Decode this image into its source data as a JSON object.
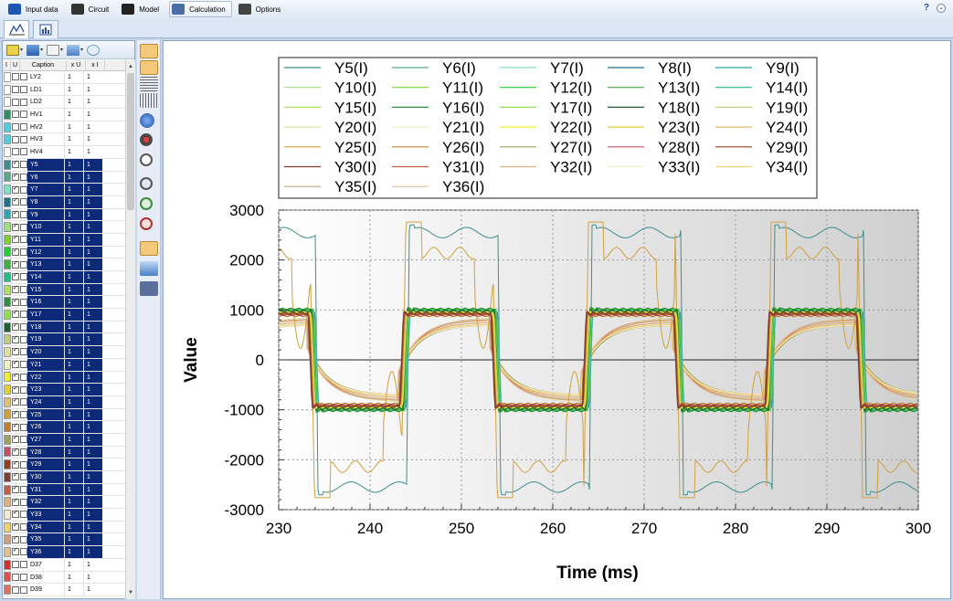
{
  "menu": [
    {
      "label": "Input data",
      "icon": "input-data-icon"
    },
    {
      "label": "Circuit",
      "icon": "circuit-icon"
    },
    {
      "label": "Model",
      "icon": "model-icon"
    },
    {
      "label": "Calculation",
      "icon": "calculation-icon",
      "active": true
    },
    {
      "label": "Options",
      "icon": "options-icon"
    }
  ],
  "help_label": "?",
  "grid": {
    "headers": [
      "I",
      "U",
      "Caption",
      "x U",
      "x I"
    ],
    "rows": [
      {
        "caption": "LY2",
        "color": "#ffffff",
        "i": false,
        "u": false,
        "xu": "1",
        "xi": "1",
        "sel": false
      },
      {
        "caption": "LD1",
        "color": "#ffffff",
        "i": false,
        "u": false,
        "xu": "1",
        "xi": "1",
        "sel": false
      },
      {
        "caption": "LD2",
        "color": "#ffffff",
        "i": false,
        "u": false,
        "xu": "1",
        "xi": "1",
        "sel": false
      },
      {
        "caption": "HV1",
        "color": "#2f8f5f",
        "i": false,
        "u": false,
        "xu": "1",
        "xi": "1",
        "sel": false
      },
      {
        "caption": "HV2",
        "color": "#4fd0e0",
        "i": false,
        "u": false,
        "xu": "1",
        "xi": "1",
        "sel": false
      },
      {
        "caption": "HV3",
        "color": "#4fd0e0",
        "i": false,
        "u": false,
        "xu": "1",
        "xi": "1",
        "sel": false
      },
      {
        "caption": "HV4",
        "color": "#ffffff",
        "i": false,
        "u": false,
        "xu": "1",
        "xi": "1",
        "sel": false
      },
      {
        "caption": "Y5",
        "color": "#3d8e8e",
        "i": true,
        "u": false,
        "xu": "1",
        "xi": "1",
        "sel": true
      },
      {
        "caption": "Y6",
        "color": "#5aa88a",
        "i": true,
        "u": false,
        "xu": "1",
        "xi": "1",
        "sel": true
      },
      {
        "caption": "Y7",
        "color": "#7fe0c8",
        "i": true,
        "u": false,
        "xu": "1",
        "xi": "1",
        "sel": true
      },
      {
        "caption": "Y8",
        "color": "#1f6f8f",
        "i": true,
        "u": false,
        "xu": "1",
        "xi": "1",
        "sel": true
      },
      {
        "caption": "Y9",
        "color": "#2fa3b5",
        "i": true,
        "u": false,
        "xu": "1",
        "xi": "1",
        "sel": true
      },
      {
        "caption": "Y10",
        "color": "#9fe07f",
        "i": true,
        "u": false,
        "xu": "1",
        "xi": "1",
        "sel": true
      },
      {
        "caption": "Y11",
        "color": "#7fd02f",
        "i": true,
        "u": false,
        "xu": "1",
        "xi": "1",
        "sel": true
      },
      {
        "caption": "Y12",
        "color": "#1fd02f",
        "i": true,
        "u": false,
        "xu": "1",
        "xi": "1",
        "sel": true
      },
      {
        "caption": "Y13",
        "color": "#3fb03f",
        "i": true,
        "u": false,
        "xu": "1",
        "xi": "1",
        "sel": true
      },
      {
        "caption": "Y14",
        "color": "#1fc07f",
        "i": true,
        "u": false,
        "xu": "1",
        "xi": "1",
        "sel": true
      },
      {
        "caption": "Y15",
        "color": "#afe05f",
        "i": true,
        "u": false,
        "xu": "1",
        "xi": "1",
        "sel": true
      },
      {
        "caption": "Y16",
        "color": "#2f8f3f",
        "i": true,
        "u": false,
        "xu": "1",
        "xi": "1",
        "sel": true
      },
      {
        "caption": "Y17",
        "color": "#8fe04f",
        "i": true,
        "u": false,
        "xu": "1",
        "xi": "1",
        "sel": true
      },
      {
        "caption": "Y18",
        "color": "#1f5f2f",
        "i": true,
        "u": false,
        "xu": "1",
        "xi": "1",
        "sel": true
      },
      {
        "caption": "Y19",
        "color": "#bfcf7f",
        "i": true,
        "u": false,
        "xu": "1",
        "xi": "1",
        "sel": true
      },
      {
        "caption": "Y20",
        "color": "#e0e0a0",
        "i": true,
        "u": false,
        "xu": "1",
        "xi": "1",
        "sel": true
      },
      {
        "caption": "Y21",
        "color": "#f0f0c0",
        "i": true,
        "u": false,
        "xu": "1",
        "xi": "1",
        "sel": true
      },
      {
        "caption": "Y22",
        "color": "#efef2f",
        "i": true,
        "u": false,
        "xu": "1",
        "xi": "1",
        "sel": true
      },
      {
        "caption": "Y23",
        "color": "#e0d02f",
        "i": true,
        "u": false,
        "xu": "1",
        "xi": "1",
        "sel": true
      },
      {
        "caption": "Y24",
        "color": "#e0c070",
        "i": true,
        "u": false,
        "xu": "1",
        "xi": "1",
        "sel": true
      },
      {
        "caption": "Y25",
        "color": "#d0a040",
        "i": true,
        "u": false,
        "xu": "1",
        "xi": "1",
        "sel": true
      },
      {
        "caption": "Y26",
        "color": "#c08030",
        "i": true,
        "u": false,
        "xu": "1",
        "xi": "1",
        "sel": true
      },
      {
        "caption": "Y27",
        "color": "#a0a060",
        "i": true,
        "u": false,
        "xu": "1",
        "xi": "1",
        "sel": true
      },
      {
        "caption": "Y28",
        "color": "#c05060",
        "i": true,
        "u": false,
        "xu": "1",
        "xi": "1",
        "sel": true
      },
      {
        "caption": "Y29",
        "color": "#8f3f1f",
        "i": true,
        "u": false,
        "xu": "1",
        "xi": "1",
        "sel": true
      },
      {
        "caption": "Y30",
        "color": "#7f3f2f",
        "i": true,
        "u": false,
        "xu": "1",
        "xi": "1",
        "sel": true
      },
      {
        "caption": "Y31",
        "color": "#c06040",
        "i": true,
        "u": false,
        "xu": "1",
        "xi": "1",
        "sel": true
      },
      {
        "caption": "Y32",
        "color": "#e0b080",
        "i": true,
        "u": false,
        "xu": "1",
        "xi": "1",
        "sel": true
      },
      {
        "caption": "Y33",
        "color": "#f5ecd0",
        "i": true,
        "u": false,
        "xu": "1",
        "xi": "1",
        "sel": true
      },
      {
        "caption": "Y34",
        "color": "#f0d070",
        "i": true,
        "u": false,
        "xu": "1",
        "xi": "1",
        "sel": true
      },
      {
        "caption": "Y35",
        "color": "#d0a080",
        "i": true,
        "u": false,
        "xu": "1",
        "xi": "1",
        "sel": true
      },
      {
        "caption": "Y36",
        "color": "#e0c090",
        "i": true,
        "u": false,
        "xu": "1",
        "xi": "1",
        "sel": true
      },
      {
        "caption": "D37",
        "color": "#d03030",
        "i": false,
        "u": false,
        "xu": "1",
        "xi": "1",
        "sel": false
      },
      {
        "caption": "D38",
        "color": "#e05050",
        "i": false,
        "u": false,
        "xu": "1",
        "xi": "1",
        "sel": false
      },
      {
        "caption": "D39",
        "color": "#e07060",
        "i": false,
        "u": false,
        "xu": "1",
        "xi": "1",
        "sel": false
      }
    ]
  },
  "chart_data": {
    "type": "line",
    "xlabel": "Time (ms)",
    "ylabel": "Value",
    "xlim": [
      230,
      300
    ],
    "ylim": [
      -3000,
      3000
    ],
    "xticks": [
      230,
      240,
      250,
      260,
      270,
      280,
      290,
      300
    ],
    "yticks": [
      3000,
      2000,
      1000,
      0,
      -1000,
      -2000,
      -3000
    ],
    "grid": true,
    "legend_position": "top",
    "period_ms": 20,
    "series": [
      {
        "name": "Y5(I)",
        "color": "#3d8e8e",
        "amp": 2600,
        "shape": "hv"
      },
      {
        "name": "Y6(I)",
        "color": "#5aa88a",
        "amp": 950,
        "shape": "sq"
      },
      {
        "name": "Y7(I)",
        "color": "#7fe0c8",
        "amp": 900,
        "shape": "sq"
      },
      {
        "name": "Y8(I)",
        "color": "#1f6f8f",
        "amp": 950,
        "shape": "sq"
      },
      {
        "name": "Y9(I)",
        "color": "#2fa3b5",
        "amp": 980,
        "shape": "sq"
      },
      {
        "name": "Y10(I)",
        "color": "#9fe07f",
        "amp": 1000,
        "shape": "sq"
      },
      {
        "name": "Y11(I)",
        "color": "#7fd02f",
        "amp": 1010,
        "shape": "sq"
      },
      {
        "name": "Y12(I)",
        "color": "#1fd02f",
        "amp": 1000,
        "shape": "sq"
      },
      {
        "name": "Y13(I)",
        "color": "#3fb03f",
        "amp": 990,
        "shape": "sq"
      },
      {
        "name": "Y14(I)",
        "color": "#1fc07f",
        "amp": 1000,
        "shape": "sq"
      },
      {
        "name": "Y15(I)",
        "color": "#afe05f",
        "amp": 970,
        "shape": "sq"
      },
      {
        "name": "Y16(I)",
        "color": "#2f8f3f",
        "amp": 1020,
        "shape": "sq"
      },
      {
        "name": "Y17(I)",
        "color": "#8fe04f",
        "amp": 960,
        "shape": "sq"
      },
      {
        "name": "Y18(I)",
        "color": "#1f5f2f",
        "amp": 980,
        "shape": "sq"
      },
      {
        "name": "Y19(I)",
        "color": "#bfcf7f",
        "amp": 900,
        "shape": "sq"
      },
      {
        "name": "Y20(I)",
        "color": "#e0e0a0",
        "amp": 850,
        "shape": "ramp"
      },
      {
        "name": "Y21(I)",
        "color": "#f0f0c0",
        "amp": 820,
        "shape": "ramp"
      },
      {
        "name": "Y22(I)",
        "color": "#efef2f",
        "amp": 940,
        "shape": "sq"
      },
      {
        "name": "Y23(I)",
        "color": "#e0d02f",
        "amp": 900,
        "shape": "sq"
      },
      {
        "name": "Y24(I)",
        "color": "#e0c070",
        "amp": 760,
        "shape": "ramp"
      },
      {
        "name": "Y25(I)",
        "color": "#d0a040",
        "amp": 2300,
        "shape": "osc"
      },
      {
        "name": "Y26(I)",
        "color": "#c08030",
        "amp": 880,
        "shape": "sq"
      },
      {
        "name": "Y27(I)",
        "color": "#a0a060",
        "amp": 700,
        "shape": "ramp"
      },
      {
        "name": "Y28(I)",
        "color": "#c05060",
        "amp": 900,
        "shape": "sq"
      },
      {
        "name": "Y29(I)",
        "color": "#8f3f1f",
        "amp": 920,
        "shape": "sq"
      },
      {
        "name": "Y30(I)",
        "color": "#7f3f2f",
        "amp": 940,
        "shape": "sq"
      },
      {
        "name": "Y31(I)",
        "color": "#c06040",
        "amp": 800,
        "shape": "ramp"
      },
      {
        "name": "Y32(I)",
        "color": "#e0b080",
        "amp": 760,
        "shape": "ramp"
      },
      {
        "name": "Y33(I)",
        "color": "#f5ecd0",
        "amp": 700,
        "shape": "ramp"
      },
      {
        "name": "Y34(I)",
        "color": "#f0d070",
        "amp": 720,
        "shape": "ramp"
      },
      {
        "name": "Y35(I)",
        "color": "#d0a080",
        "amp": 820,
        "shape": "ramp"
      },
      {
        "name": "Y36(I)",
        "color": "#e0c090",
        "amp": 800,
        "shape": "ramp"
      }
    ]
  }
}
